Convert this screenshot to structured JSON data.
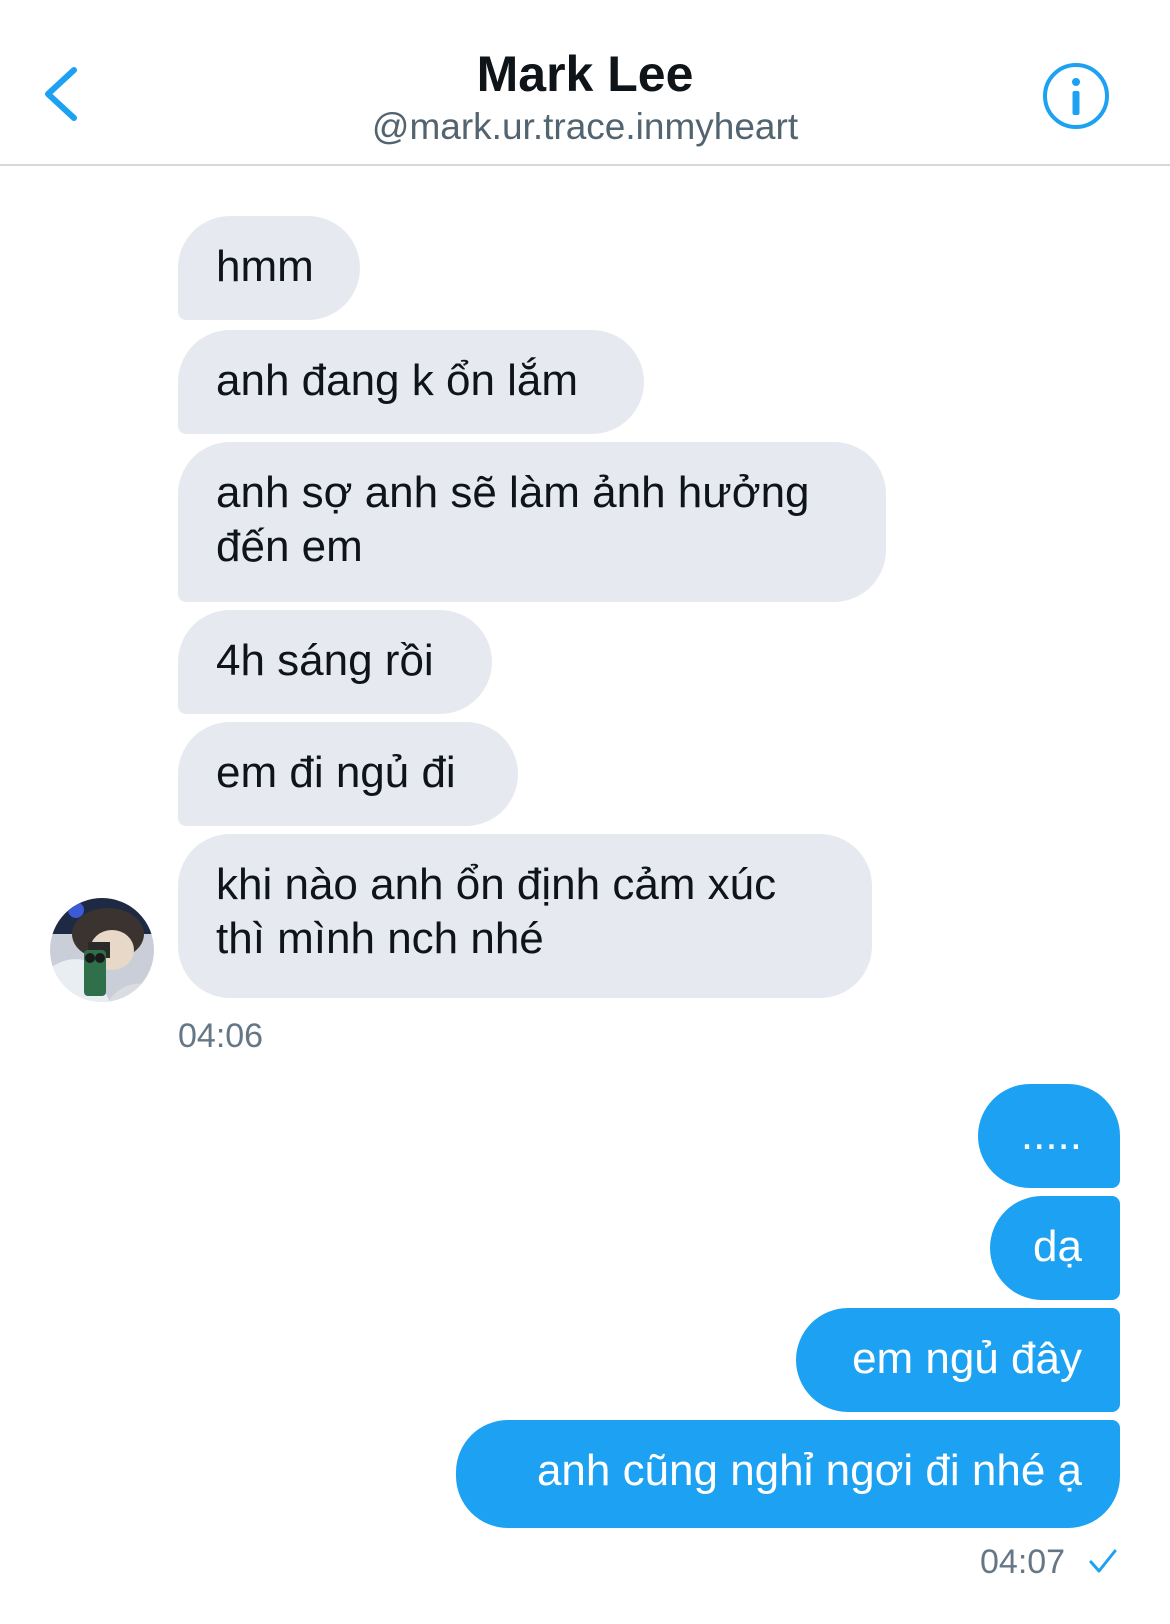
{
  "header": {
    "name": "Mark Lee",
    "handle": "@mark.ur.trace.inmyheart",
    "back_icon": "chevron-left-icon",
    "info_icon": "info-icon",
    "accent_color": "#1da1f2"
  },
  "messages": {
    "received": [
      "hmm",
      "anh đang k ổn lắm",
      "anh sợ anh sẽ làm ảnh hưởng đến em",
      "4h sáng rồi",
      "em đi ngủ đi",
      "khi nào anh ổn định cảm xúc thì mình nch nhé"
    ],
    "received_time": "04:06",
    "sent": [
      ".....",
      "dạ",
      "em ngủ đây",
      "anh cũng nghỉ ngơi đi nhé ạ"
    ],
    "sent_time": "04:07",
    "sent_status_icon": "checkmark-icon"
  },
  "colors": {
    "received_bubble": "#e6e9ef",
    "sent_bubble": "#1da1f2",
    "timestamp": "#657786"
  }
}
